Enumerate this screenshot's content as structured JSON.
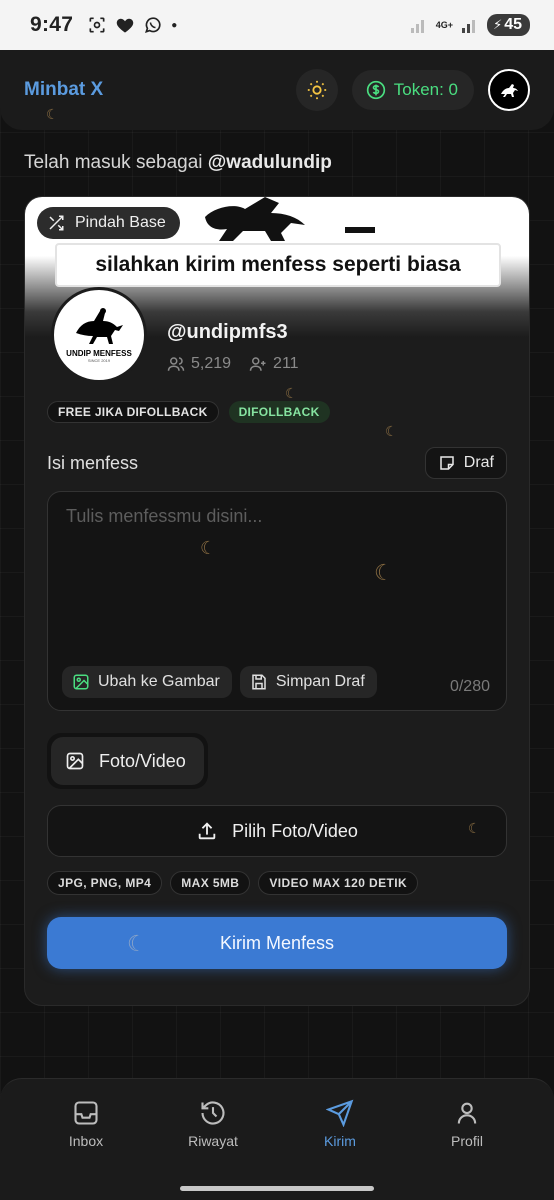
{
  "status_bar": {
    "time": "9:47",
    "network_label": "4G+",
    "battery_level": "45"
  },
  "header": {
    "app_title": "Minbat X",
    "token_label": "Token: 0",
    "avatar_icon": "logo-avatar-icon"
  },
  "session": {
    "prefix": "Telah masuk sebagai ",
    "username": "@wadulundip"
  },
  "card": {
    "switch_base_label": "Pindah Base",
    "banner_caption": "silahkan kirim menfess seperti biasa",
    "avatar_label": "UNDIP MENFESS",
    "avatar_sublabel": "SINCE 2019",
    "handle": "@undipmfs3",
    "followers": "5,219",
    "following": "211",
    "badges": [
      "FREE JIKA DIFOLLBACK",
      "DIFOLLBACK"
    ],
    "section_label": "Isi menfess",
    "draft_button": "Draf",
    "textarea_placeholder": "Tulis menfessmu disini...",
    "convert_image_button": "Ubah ke Gambar",
    "save_draft_button": "Simpan Draf",
    "char_counter": "0/280",
    "media_tab_label": "Foto/Video",
    "pick_media_button": "Pilih Foto/Video",
    "formats": [
      "JPG, PNG, MP4",
      "MAX 5MB",
      "VIDEO MAX 120 DETIK"
    ],
    "submit_button": "Kirim Menfess"
  },
  "bottom_nav": {
    "items": [
      {
        "label": "Inbox",
        "icon": "inbox-icon"
      },
      {
        "label": "Riwayat",
        "icon": "history-icon"
      },
      {
        "label": "Kirim",
        "icon": "send-icon",
        "active": true
      },
      {
        "label": "Profil",
        "icon": "user-icon"
      }
    ]
  },
  "colors": {
    "accent": "#3b7ad3",
    "title_blue": "#5b9bdf",
    "token_green": "#4ade80",
    "badge_green": "#86e3a0",
    "sun_yellow": "#f5c542"
  }
}
